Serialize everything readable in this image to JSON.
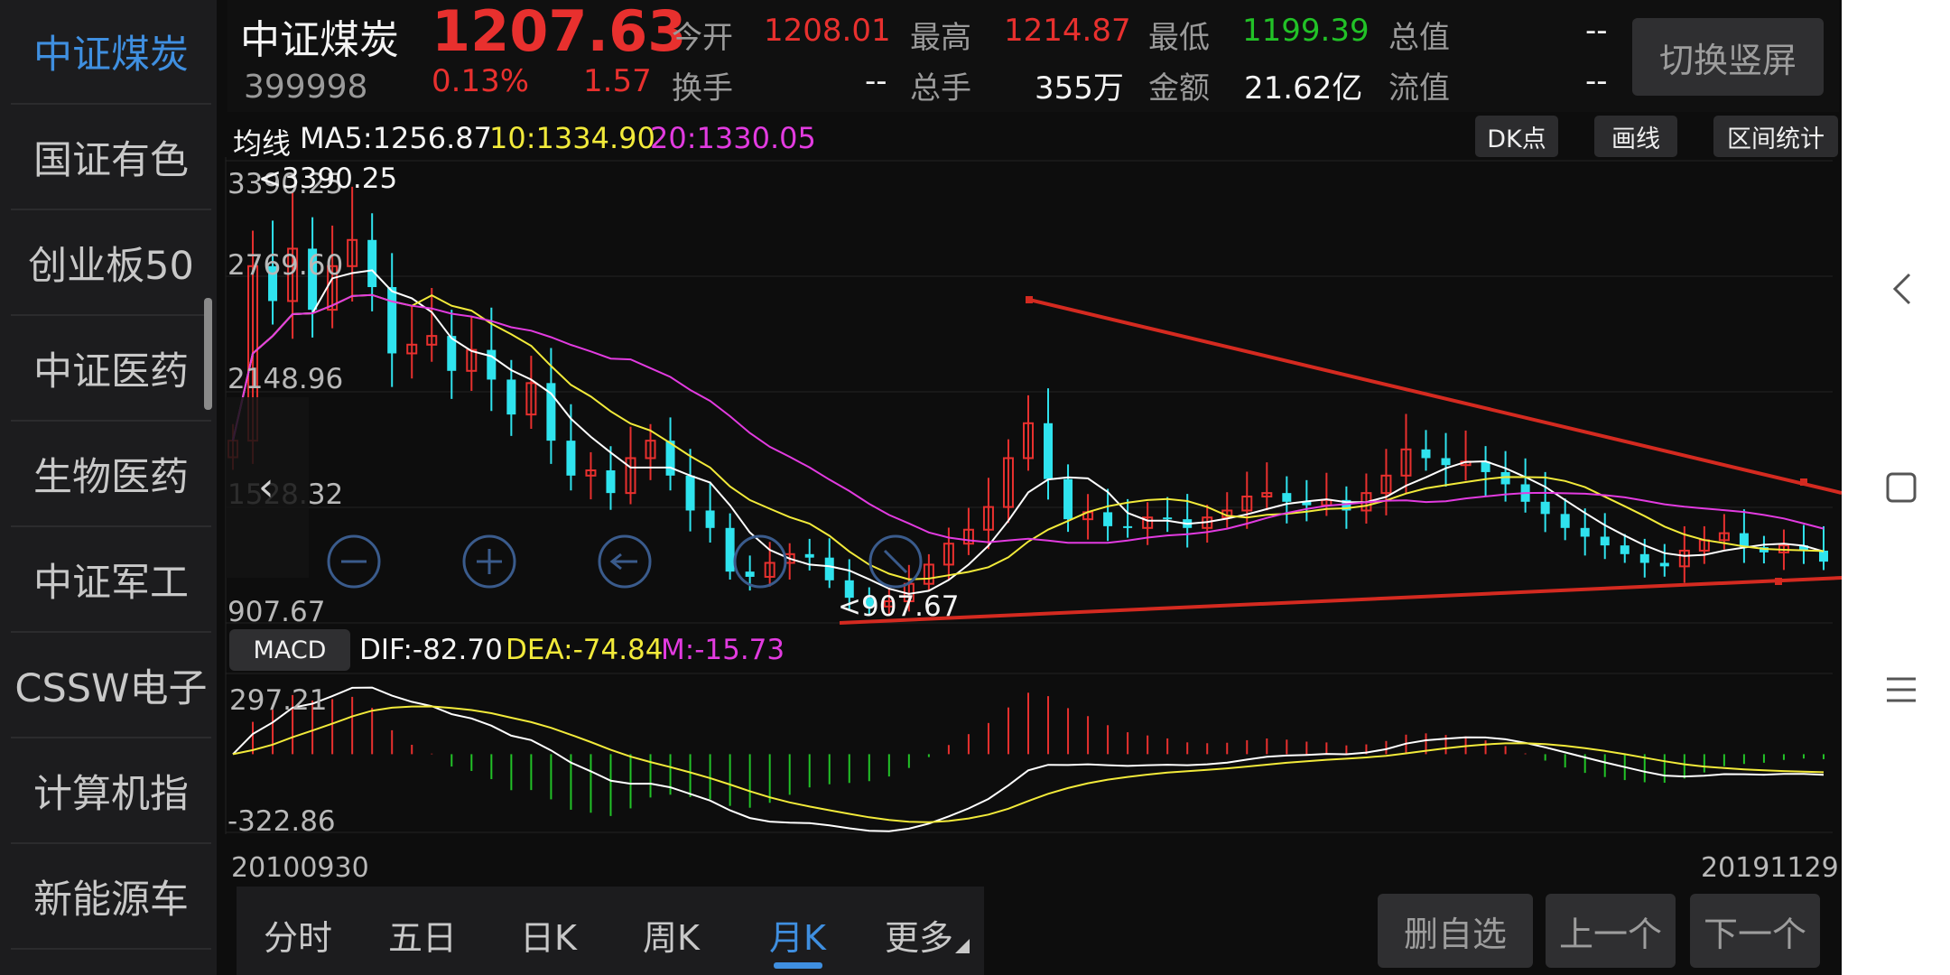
{
  "sidebar": {
    "items": [
      {
        "label": "中证煤炭",
        "active": true
      },
      {
        "label": "国证有色",
        "active": false
      },
      {
        "label": "创业板50",
        "active": false
      },
      {
        "label": "中证医药",
        "active": false
      },
      {
        "label": "生物医药",
        "active": false
      },
      {
        "label": "中证军工",
        "active": false
      },
      {
        "label": "CSSW电子",
        "active": false
      },
      {
        "label": "计算机指",
        "active": false
      },
      {
        "label": "新能源车",
        "active": false
      }
    ]
  },
  "quote": {
    "name": "中证煤炭",
    "code": "399998",
    "price": "1207.63",
    "change_pct": "0.13%",
    "change": "1.57",
    "fields": {
      "open_label": "今开",
      "open": "1208.01",
      "turnover_label": "换手",
      "turnover": "--",
      "high_label": "最高",
      "high": "1214.87",
      "total_hands_label": "总手",
      "total_hands": "355万",
      "low_label": "最低",
      "low": "1199.39",
      "amount_label": "金额",
      "amount": "21.62亿",
      "mktcap_label": "总值",
      "mktcap": "--",
      "float_label": "流值",
      "float": "--"
    },
    "switch_label": "切换竖屏"
  },
  "ma": {
    "label": "均线",
    "ma5": "MA5:1256.87",
    "ma10": "10:1334.90",
    "ma20": "20:1330.05",
    "colors": {
      "ma5": "#ffffff",
      "ma10": "#f2ea3a",
      "ma20": "#e23be0"
    }
  },
  "tools": {
    "dk": "DK点",
    "draw": "画线",
    "range": "区间统计"
  },
  "kline": {
    "high_label": "3390.25",
    "low_label": "907.67",
    "axis": [
      "3390.25",
      "2769.60",
      "2148.96",
      "1528.32",
      "907.67"
    ]
  },
  "macd": {
    "button": "MACD",
    "dif": "DIF:-82.70",
    "dea": "DEA:-74.84",
    "m": "M:-15.73",
    "axis_top": "297.21",
    "axis_bottom": "-322.86"
  },
  "dates": {
    "start": "20100930",
    "end": "20191129"
  },
  "tabs": [
    {
      "label": "分时",
      "active": false
    },
    {
      "label": "五日",
      "active": false
    },
    {
      "label": "日K",
      "active": false
    },
    {
      "label": "周K",
      "active": false
    },
    {
      "label": "月K",
      "active": true
    },
    {
      "label": "更多",
      "active": false
    }
  ],
  "actions": {
    "remove_watch": "删自选",
    "prev": "上一个",
    "next": "下一个"
  },
  "chart_data": {
    "type": "candlestick",
    "period": "monthly",
    "x_range": [
      "20100930",
      "20191129"
    ],
    "price_range": [
      907.67,
      3390.25
    ],
    "macd_range": [
      -322.86,
      297.21
    ],
    "ma_series": [
      {
        "name": "MA5",
        "latest": 1256.87
      },
      {
        "name": "10",
        "latest": 1334.9
      },
      {
        "name": "20",
        "latest": 1330.05
      }
    ],
    "closes": [
      1900,
      2900,
      2700,
      3000,
      2650,
      2900,
      3050,
      2780,
      2400,
      2450,
      2500,
      2300,
      2420,
      2250,
      2050,
      2230,
      1900,
      1700,
      1730,
      1600,
      1800,
      1900,
      1700,
      1500,
      1400,
      1150,
      1120,
      1200,
      1250,
      1230,
      1100,
      1000,
      950,
      980,
      1080,
      1190,
      1310,
      1390,
      1520,
      1800,
      2000,
      1680,
      1450,
      1490,
      1410,
      1400,
      1460,
      1450,
      1400,
      1460,
      1500,
      1580,
      1600,
      1550,
      1530,
      1560,
      1500,
      1600,
      1700,
      1850,
      1800,
      1760,
      1780,
      1720,
      1650,
      1550,
      1480,
      1400,
      1350,
      1300,
      1250,
      1200,
      1180,
      1270,
      1330,
      1370,
      1290,
      1260,
      1300,
      1270,
      1207
    ]
  }
}
